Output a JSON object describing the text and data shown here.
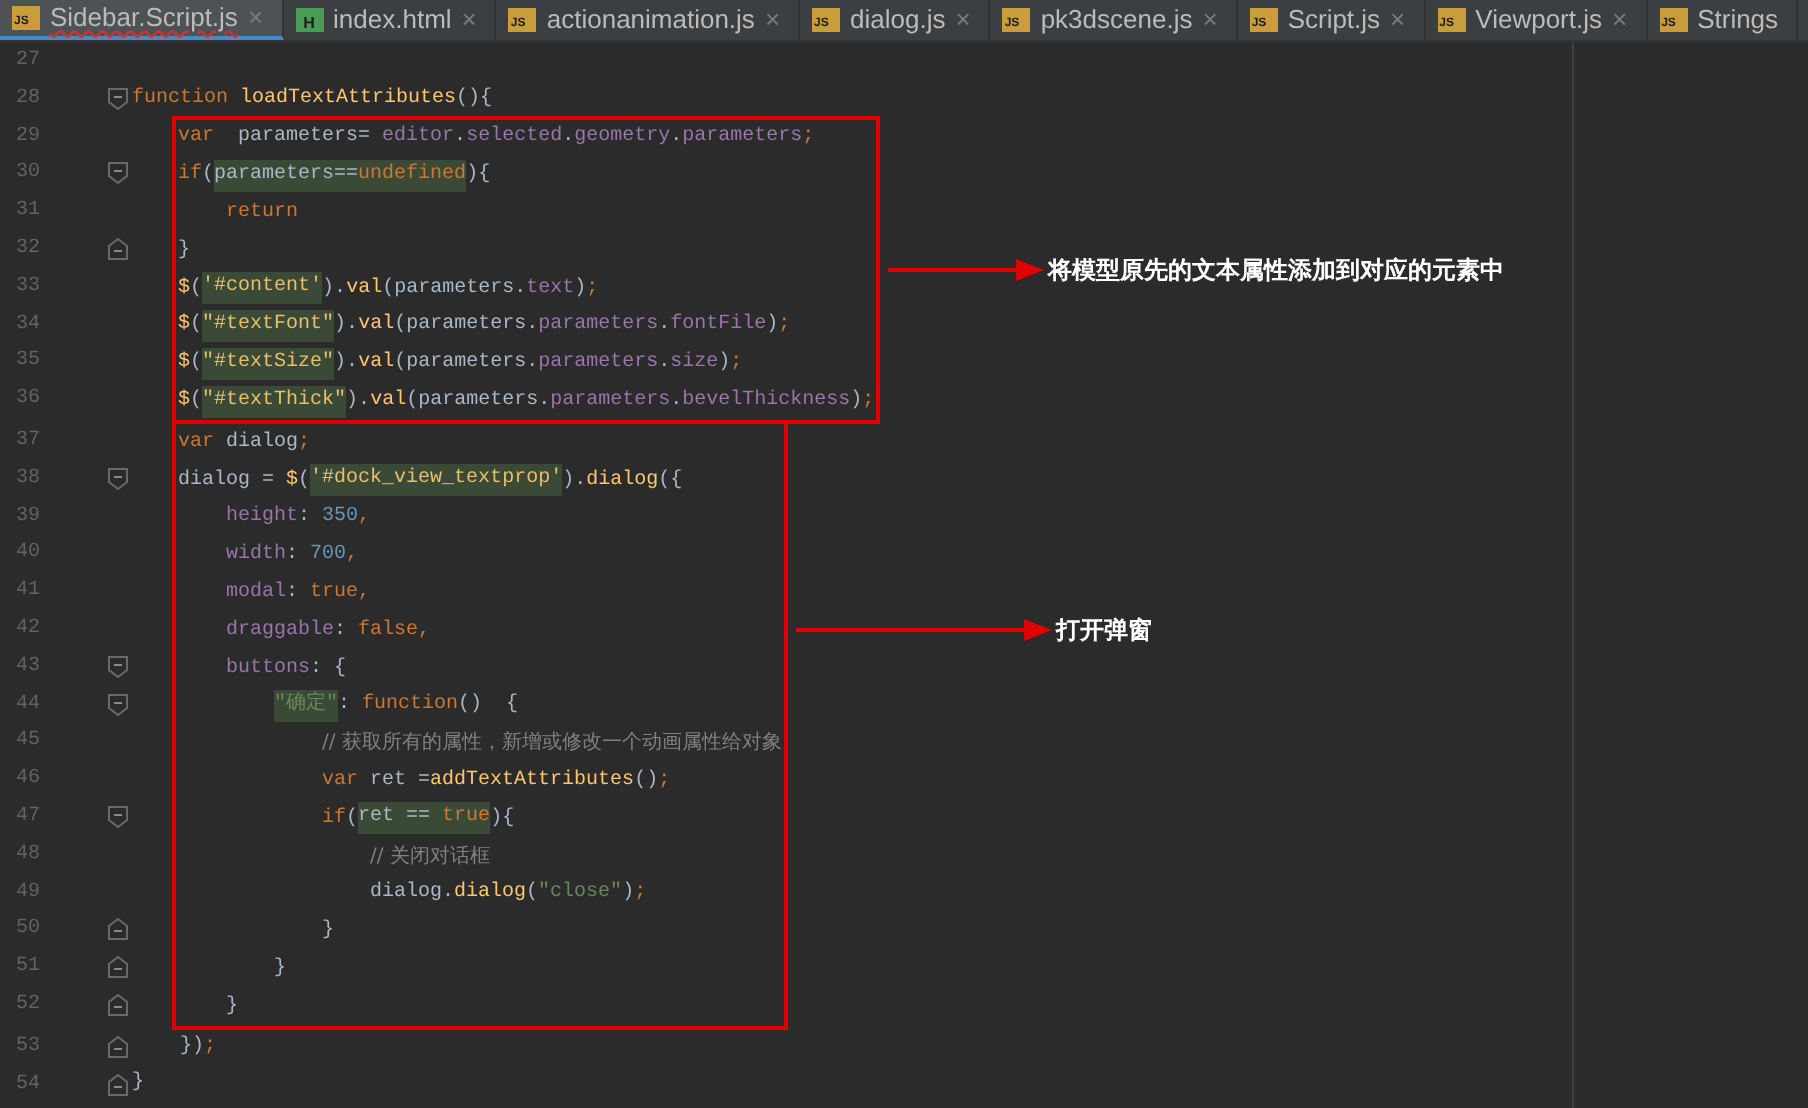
{
  "tabs": [
    {
      "label": "Sidebar.Script.js",
      "icon_text": "JS",
      "kind": "js",
      "selected": true,
      "closable": true,
      "close_glyph": "×"
    },
    {
      "label": "index.html",
      "icon_text": "H",
      "kind": "html",
      "selected": false,
      "closable": true,
      "close_glyph": "×"
    },
    {
      "label": "actionanimation.js",
      "icon_text": "JS",
      "kind": "js",
      "selected": false,
      "closable": true,
      "close_glyph": "×"
    },
    {
      "label": "dialog.js",
      "icon_text": "JS",
      "kind": "js",
      "selected": false,
      "closable": true,
      "close_glyph": "×"
    },
    {
      "label": "pk3dscene.js",
      "icon_text": "JS",
      "kind": "js",
      "selected": false,
      "closable": true,
      "close_glyph": "×"
    },
    {
      "label": "Script.js",
      "icon_text": "JS",
      "kind": "js",
      "selected": false,
      "closable": true,
      "close_glyph": "×"
    },
    {
      "label": "Viewport.js",
      "icon_text": "JS",
      "kind": "js",
      "selected": false,
      "closable": true,
      "close_glyph": "×"
    },
    {
      "label": "Strings",
      "icon_text": "JS",
      "kind": "js",
      "selected": false,
      "closable": false
    }
  ],
  "code": [
    {
      "kind": "line",
      "number": "27"
    },
    {
      "kind": "line",
      "number": "28",
      "fold_open": true,
      "tokens": [
        {
          "kind": "kw",
          "text": "function"
        },
        {
          "kind": "fn",
          "text": " loadTextAttributes"
        },
        {
          "kind": "plain",
          "text": "(){"
        }
      ],
      "children": [
        {
          "kind": "annotation",
          "note": "将模型原先的文本属性添加到对应的元素中",
          "children": [
            {
              "kind": "line",
              "number": "29",
              "tokens": [
                {
                  "kind": "kw",
                  "text": "var"
                },
                {
                  "kind": "plain",
                  "text": "  parameters= "
                },
                {
                  "kind": "prop",
                  "text": "editor"
                },
                {
                  "kind": "plain",
                  "text": "."
                },
                {
                  "kind": "prop",
                  "text": "selected"
                },
                {
                  "kind": "plain",
                  "text": "."
                },
                {
                  "kind": "prop",
                  "text": "geometry"
                },
                {
                  "kind": "plain",
                  "text": "."
                },
                {
                  "kind": "prop",
                  "text": "parameters"
                },
                {
                  "kind": "kw",
                  "text": ";"
                }
              ]
            },
            {
              "kind": "line",
              "number": "30",
              "fold_open": true,
              "tokens": [
                {
                  "kind": "kw",
                  "text": "if"
                },
                {
                  "kind": "plain",
                  "text": "("
                },
                {
                  "kind": "plain",
                  "text": "parameters==",
                  "hl": true
                },
                {
                  "kind": "kw",
                  "text": "undefined",
                  "hl": true
                },
                {
                  "kind": "plain",
                  "text": "){"
                }
              ],
              "children": [
                {
                  "kind": "line",
                  "number": "31",
                  "tokens": [
                    {
                      "kind": "kw",
                      "text": "return"
                    }
                  ]
                }
              ]
            },
            {
              "kind": "line",
              "number": "32",
              "fold_close": true,
              "tokens": [
                {
                  "kind": "plain",
                  "text": "}"
                }
              ]
            },
            {
              "kind": "line",
              "number": "33",
              "tokens": [
                {
                  "kind": "fn",
                  "text": "$"
                },
                {
                  "kind": "plain",
                  "text": "("
                },
                {
                  "kind": "sel",
                  "text": "'#content'",
                  "hl": true
                },
                {
                  "kind": "plain",
                  "text": ")."
                },
                {
                  "kind": "fn",
                  "text": "val"
                },
                {
                  "kind": "plain",
                  "text": "(parameters."
                },
                {
                  "kind": "prop",
                  "text": "text"
                },
                {
                  "kind": "plain",
                  "text": ")"
                },
                {
                  "kind": "kw",
                  "text": ";"
                }
              ]
            },
            {
              "kind": "line",
              "number": "34",
              "tokens": [
                {
                  "kind": "fn",
                  "text": "$"
                },
                {
                  "kind": "plain",
                  "text": "("
                },
                {
                  "kind": "sel",
                  "text": "\"#textFont\"",
                  "hl": true
                },
                {
                  "kind": "plain",
                  "text": ")."
                },
                {
                  "kind": "fn",
                  "text": "val"
                },
                {
                  "kind": "plain",
                  "text": "(parameters."
                },
                {
                  "kind": "prop",
                  "text": "parameters"
                },
                {
                  "kind": "plain",
                  "text": "."
                },
                {
                  "kind": "prop",
                  "text": "fontFile"
                },
                {
                  "kind": "plain",
                  "text": ")"
                },
                {
                  "kind": "kw",
                  "text": ";"
                }
              ]
            },
            {
              "kind": "line",
              "number": "35",
              "tokens": [
                {
                  "kind": "fn",
                  "text": "$"
                },
                {
                  "kind": "plain",
                  "text": "("
                },
                {
                  "kind": "sel",
                  "text": "\"#textSize\"",
                  "hl": true
                },
                {
                  "kind": "plain",
                  "text": ")."
                },
                {
                  "kind": "fn",
                  "text": "val"
                },
                {
                  "kind": "plain",
                  "text": "(parameters."
                },
                {
                  "kind": "prop",
                  "text": "parameters"
                },
                {
                  "kind": "plain",
                  "text": "."
                },
                {
                  "kind": "prop",
                  "text": "size"
                },
                {
                  "kind": "plain",
                  "text": ")"
                },
                {
                  "kind": "kw",
                  "text": ";"
                }
              ]
            },
            {
              "kind": "line",
              "number": "36",
              "tokens": [
                {
                  "kind": "fn",
                  "text": "$"
                },
                {
                  "kind": "plain",
                  "text": "("
                },
                {
                  "kind": "sel",
                  "text": "\"#textThick\"",
                  "hl": true
                },
                {
                  "kind": "plain",
                  "text": ")."
                },
                {
                  "kind": "fn",
                  "text": "val"
                },
                {
                  "kind": "plain",
                  "text": "(parameters."
                },
                {
                  "kind": "prop",
                  "text": "parameters"
                },
                {
                  "kind": "plain",
                  "text": "."
                },
                {
                  "kind": "prop",
                  "text": "bevelThickness"
                },
                {
                  "kind": "plain",
                  "text": ")"
                },
                {
                  "kind": "kw",
                  "text": ";"
                }
              ]
            }
          ]
        },
        {
          "kind": "annotation",
          "note": "打开弹窗",
          "children": [
            {
              "kind": "line",
              "number": "37",
              "tokens": [
                {
                  "kind": "kw",
                  "text": "var"
                },
                {
                  "kind": "plain",
                  "text": " dialog"
                },
                {
                  "kind": "kw",
                  "text": ";"
                }
              ]
            },
            {
              "kind": "line",
              "number": "38",
              "fold_open": true,
              "tokens": [
                {
                  "kind": "plain",
                  "text": "dialog = "
                },
                {
                  "kind": "fn",
                  "text": "$"
                },
                {
                  "kind": "plain",
                  "text": "("
                },
                {
                  "kind": "sel",
                  "text": "'#dock_view_textprop'",
                  "hl": true
                },
                {
                  "kind": "plain",
                  "text": ")."
                },
                {
                  "kind": "fn",
                  "text": "dialog"
                },
                {
                  "kind": "plain",
                  "text": "({"
                }
              ],
              "children": [
                {
                  "kind": "line",
                  "number": "39",
                  "tokens": [
                    {
                      "kind": "prop",
                      "text": "height"
                    },
                    {
                      "kind": "plain",
                      "text": ": "
                    },
                    {
                      "kind": "num",
                      "text": "350"
                    },
                    {
                      "kind": "kw",
                      "text": ","
                    }
                  ]
                },
                {
                  "kind": "line",
                  "number": "40",
                  "tokens": [
                    {
                      "kind": "prop",
                      "text": "width"
                    },
                    {
                      "kind": "plain",
                      "text": ": "
                    },
                    {
                      "kind": "num",
                      "text": "700"
                    },
                    {
                      "kind": "kw",
                      "text": ","
                    }
                  ]
                },
                {
                  "kind": "line",
                  "number": "41",
                  "tokens": [
                    {
                      "kind": "prop",
                      "text": "modal"
                    },
                    {
                      "kind": "plain",
                      "text": ": "
                    },
                    {
                      "kind": "kw",
                      "text": "true"
                    },
                    {
                      "kind": "kw",
                      "text": ","
                    }
                  ]
                },
                {
                  "kind": "line",
                  "number": "42",
                  "tokens": [
                    {
                      "kind": "prop",
                      "text": "draggable"
                    },
                    {
                      "kind": "plain",
                      "text": ": "
                    },
                    {
                      "kind": "kw",
                      "text": "false"
                    },
                    {
                      "kind": "kw",
                      "text": ","
                    }
                  ]
                },
                {
                  "kind": "line",
                  "number": "43",
                  "fold_open": true,
                  "tokens": [
                    {
                      "kind": "prop",
                      "text": "buttons"
                    },
                    {
                      "kind": "plain",
                      "text": ": {"
                    }
                  ],
                  "children": [
                    {
                      "kind": "line",
                      "number": "44",
                      "fold_open": true,
                      "tokens": [
                        {
                          "kind": "str",
                          "text": "\"确定\"",
                          "hl": true
                        },
                        {
                          "kind": "plain",
                          "text": ": "
                        },
                        {
                          "kind": "kw",
                          "text": "function"
                        },
                        {
                          "kind": "plain",
                          "text": "()  {"
                        }
                      ],
                      "children": [
                        {
                          "kind": "line",
                          "number": "45",
                          "tokens": [
                            {
                              "kind": "comment",
                              "text": "// 获取所有的属性，新增或修改一个动画属性给对象"
                            }
                          ]
                        },
                        {
                          "kind": "line",
                          "number": "46",
                          "tokens": [
                            {
                              "kind": "kw",
                              "text": "var"
                            },
                            {
                              "kind": "plain",
                              "text": " ret ="
                            },
                            {
                              "kind": "fn",
                              "text": "addTextAttributes"
                            },
                            {
                              "kind": "plain",
                              "text": "()"
                            },
                            {
                              "kind": "kw",
                              "text": ";"
                            }
                          ]
                        },
                        {
                          "kind": "line",
                          "number": "47",
                          "fold_open": true,
                          "tokens": [
                            {
                              "kind": "kw",
                              "text": "if"
                            },
                            {
                              "kind": "plain",
                              "text": "("
                            },
                            {
                              "kind": "plain",
                              "text": "ret == ",
                              "hl": true
                            },
                            {
                              "kind": "kw",
                              "text": "true",
                              "hl": true
                            },
                            {
                              "kind": "plain",
                              "text": "){"
                            }
                          ],
                          "children": [
                            {
                              "kind": "line",
                              "number": "48",
                              "tokens": [
                                {
                                  "kind": "comment",
                                  "text": "// 关闭对话框"
                                }
                              ]
                            },
                            {
                              "kind": "line",
                              "number": "49",
                              "tokens": [
                                {
                                  "kind": "plain",
                                  "text": "dialog."
                                },
                                {
                                  "kind": "fn",
                                  "text": "dialog"
                                },
                                {
                                  "kind": "plain",
                                  "text": "("
                                },
                                {
                                  "kind": "str",
                                  "text": "\"close\""
                                },
                                {
                                  "kind": "plain",
                                  "text": ")"
                                },
                                {
                                  "kind": "kw",
                                  "text": ";"
                                }
                              ]
                            }
                          ]
                        },
                        {
                          "kind": "line",
                          "number": "50",
                          "fold_close": true,
                          "tokens": [
                            {
                              "kind": "plain",
                              "text": "}"
                            }
                          ]
                        }
                      ]
                    },
                    {
                      "kind": "line",
                      "number": "51",
                      "fold_close": true,
                      "tokens": [
                        {
                          "kind": "plain",
                          "text": "}"
                        }
                      ]
                    }
                  ]
                },
                {
                  "kind": "line",
                  "number": "52",
                  "fold_close": true,
                  "tokens": [
                    {
                      "kind": "plain",
                      "text": "}"
                    }
                  ]
                }
              ]
            }
          ]
        },
        {
          "kind": "line",
          "number": "53",
          "fold_close": true,
          "tokens": [
            {
              "kind": "plain",
              "text": "})"
            },
            {
              "kind": "kw",
              "text": ";"
            }
          ]
        }
      ]
    },
    {
      "kind": "line",
      "number": "54",
      "fold_close": true,
      "tokens": [
        {
          "kind": "plain",
          "text": "}"
        }
      ]
    }
  ]
}
